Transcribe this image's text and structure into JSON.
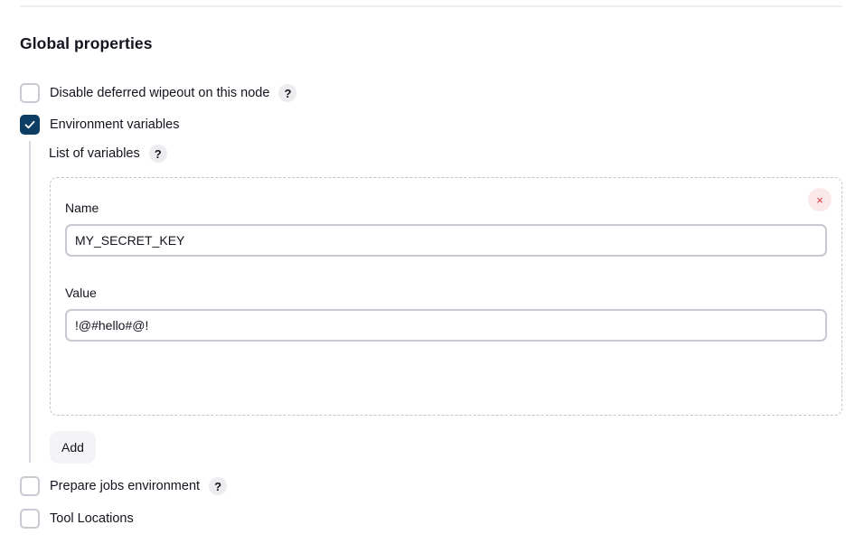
{
  "section": {
    "title": "Global properties"
  },
  "options": {
    "disable_wipeout": {
      "label": "Disable deferred wipeout on this node",
      "checked": false,
      "help": "?"
    },
    "env_vars": {
      "label": "Environment variables",
      "checked": true
    },
    "prepare_jobs": {
      "label": "Prepare jobs environment",
      "checked": false,
      "help": "?"
    },
    "tool_locations": {
      "label": "Tool Locations",
      "checked": false
    }
  },
  "env": {
    "list_label": "List of variables",
    "list_help": "?",
    "variables": [
      {
        "name_label": "Name",
        "name_value": "MY_SECRET_KEY",
        "value_label": "Value",
        "value_value": "!@#hello#@!",
        "remove_glyph": "×"
      }
    ],
    "add_label": "Add"
  },
  "colors": {
    "accent": "#0e3d63",
    "remove_red": "#d4313e",
    "remove_bg": "#fbe9ea"
  }
}
